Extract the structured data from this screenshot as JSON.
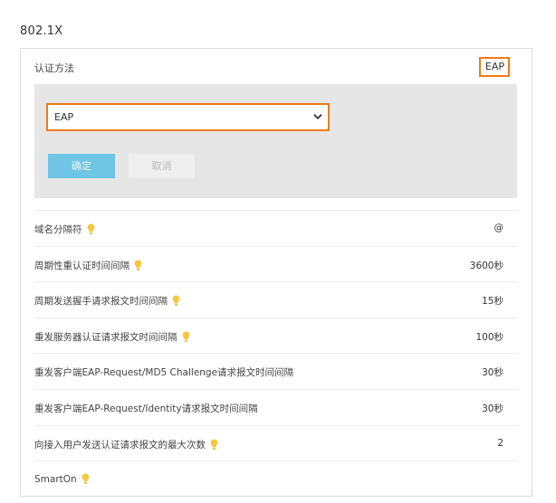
{
  "section_title": "802.1X",
  "auth_method": {
    "label": "认证方法",
    "value": "EAP"
  },
  "edit": {
    "select_value": "EAP",
    "confirm_label": "确定",
    "cancel_label": "取消"
  },
  "rows": [
    {
      "label": "域名分隔符",
      "value": "@",
      "has_tip": true
    },
    {
      "label": "周期性重认证时间间隔",
      "value": "3600秒",
      "has_tip": true
    },
    {
      "label": "周期发送握手请求报文时间间隔",
      "value": "15秒",
      "has_tip": true
    },
    {
      "label": "重发服务器认证请求报文时间间隔",
      "value": "100秒",
      "has_tip": true
    },
    {
      "label": "重发客户端EAP-Request/MD5 Challenge请求报文时间间隔",
      "value": "30秒",
      "has_tip": false
    },
    {
      "label": "重发客户端EAP-Request/Identity请求报文时间间隔",
      "value": "30秒",
      "has_tip": false
    },
    {
      "label": "向接入用户发送认证请求报文的最大次数",
      "value": "2",
      "has_tip": true
    },
    {
      "label": "SmartOn",
      "value": "",
      "has_tip": true
    }
  ],
  "colors": {
    "highlight": "#f07c16",
    "confirm_button": "#6fc6e4",
    "tip_icon": "#f5c842"
  },
  "icons": {
    "tip": "lightbulb-icon",
    "dropdown": "chevron-down-icon"
  }
}
